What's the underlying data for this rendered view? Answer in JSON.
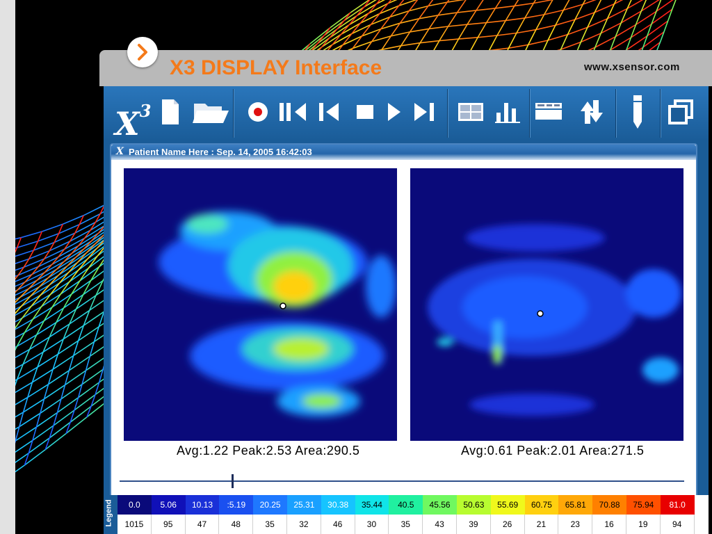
{
  "slide": {
    "title": "X3 DISPLAY Interface",
    "site": "www.xsensor.com"
  },
  "toolbar": {
    "logo": "X",
    "logo_sup": "3",
    "buttons": [
      {
        "name": "new-file",
        "icon": "document-icon"
      },
      {
        "name": "open-folder",
        "icon": "folder-icon"
      },
      {
        "name": "record",
        "icon": "record-icon"
      },
      {
        "name": "skip-to-start",
        "icon": "skip-start-icon"
      },
      {
        "name": "step-back",
        "icon": "step-back-icon"
      },
      {
        "name": "stop",
        "icon": "stop-icon"
      },
      {
        "name": "play",
        "icon": "play-icon"
      },
      {
        "name": "skip-to-end",
        "icon": "skip-end-icon"
      },
      {
        "name": "grid-stats",
        "icon": "grid-icon"
      },
      {
        "name": "bar-chart",
        "icon": "bar-chart-icon"
      },
      {
        "name": "data-table",
        "icon": "table-icon"
      },
      {
        "name": "sort",
        "icon": "up-down-arrows-icon"
      },
      {
        "name": "pen",
        "icon": "pen-icon"
      },
      {
        "name": "window",
        "icon": "window-icon"
      }
    ]
  },
  "window": {
    "title": "Patient Name Here : Sep. 14, 2005 16:42:03",
    "logo": "X"
  },
  "maps": [
    {
      "stats": "Avg:1.22 Peak:2.53 Area:290.5"
    },
    {
      "stats": "Avg:0.61 Peak:2.01 Area:271.5"
    }
  ],
  "playback": {
    "position": 0.2
  },
  "legend": {
    "label": "Legend",
    "values": [
      "0.0",
      "5.06",
      "10.13",
      ":5.19",
      "20.25",
      "25.31",
      "30.38",
      "35.44",
      "40.5",
      "45.56",
      "50.63",
      "55.69",
      "60.75",
      "65.81",
      "70.88",
      "75.94",
      "81.0"
    ],
    "colors": [
      "#0a0a7a",
      "#1010b8",
      "#1a30d8",
      "#1a50f0",
      "#1e78ff",
      "#1aa0ff",
      "#16c4ff",
      "#10e4e8",
      "#20f0a0",
      "#70f860",
      "#b8fc30",
      "#f0f81c",
      "#ffd010",
      "#ffa808",
      "#ff8000",
      "#ff5000",
      "#e80000"
    ],
    "text_colors": [
      "#ffffff",
      "#ffffff",
      "#ffffff",
      "#ffffff",
      "#ffffff",
      "#ffffff",
      "#ffffff",
      "#000000",
      "#000000",
      "#000000",
      "#000000",
      "#000000",
      "#000000",
      "#000000",
      "#000000",
      "#000000",
      "#ffffff"
    ],
    "counts": [
      "1015",
      "95",
      "47",
      "48",
      "35",
      "32",
      "46",
      "30",
      "35",
      "43",
      "39",
      "26",
      "21",
      "23",
      "16",
      "19",
      "94"
    ]
  }
}
